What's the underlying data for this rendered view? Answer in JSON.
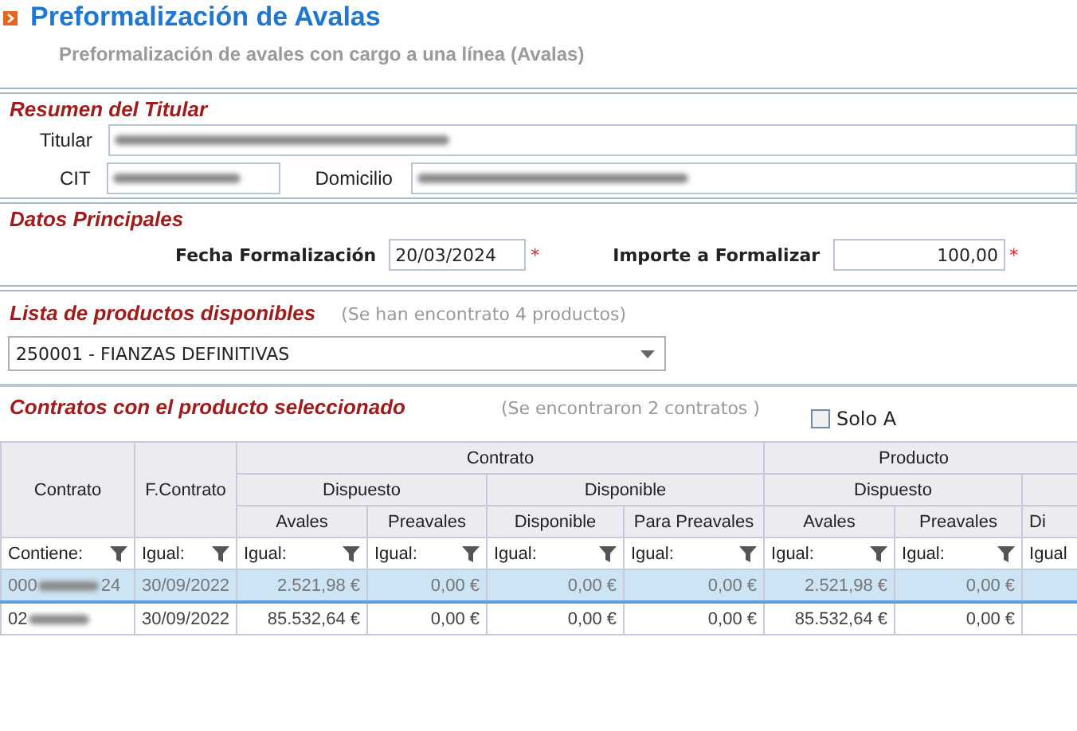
{
  "header": {
    "title": "Preformalización de Avalas",
    "subtitle": "Preformalización de avales con cargo a una línea (Avalas)"
  },
  "titular": {
    "title": "Resumen del Titular",
    "titular_label": "Titular",
    "cit_label": "CIT",
    "domicilio_label": "Domicilio"
  },
  "datos": {
    "title": "Datos Principales",
    "fields": [
      {
        "kind": "date",
        "label": "Fecha Formalización",
        "value": "20/03/2024",
        "required_mark": "*"
      },
      {
        "kind": "amount",
        "label": "Importe a Formalizar",
        "value": "100,00",
        "required_mark": "*"
      }
    ]
  },
  "productos": {
    "title": "Lista de productos disponibles",
    "note": "(Se han encontrato 4 productos)",
    "selected_product": "250001 - FIANZAS DEFINITIVAS"
  },
  "contratos": {
    "title": "Contratos con el producto seleccionado",
    "note": "(Se encontraron 2 contratos )",
    "checkbox": {
      "label": "Solo A",
      "checked": false
    },
    "table": {
      "groups": [
        "Contrato",
        "Producto"
      ],
      "subgroups": [
        "Dispuesto",
        "Disponible",
        "Dispuesto"
      ],
      "columns": [
        "Contrato",
        "F.Contrato",
        "Avales",
        "Preavales",
        "Disponible",
        "Para Preavales",
        "Avales",
        "Preavales",
        "Di"
      ],
      "filters": [
        "Contiene:",
        "Igual:",
        "Igual:",
        "Igual:",
        "Igual:",
        "Igual:",
        "Igual:",
        "Igual:",
        "Igual"
      ],
      "rows": [
        {
          "selected": true,
          "contrato_suffix": "24",
          "cells": [
            "000",
            "30/09/2022",
            "2.521,98 €",
            "0,00 €",
            "0,00 €",
            "0,00 €",
            "2.521,98 €",
            "0,00 €"
          ]
        },
        {
          "selected": false,
          "cells": [
            "02",
            "30/09/2022",
            "85.532,64 €",
            "0,00 €",
            "0,00 €",
            "0,00 €",
            "85.532,64 €",
            "0,00 €"
          ]
        }
      ]
    }
  }
}
